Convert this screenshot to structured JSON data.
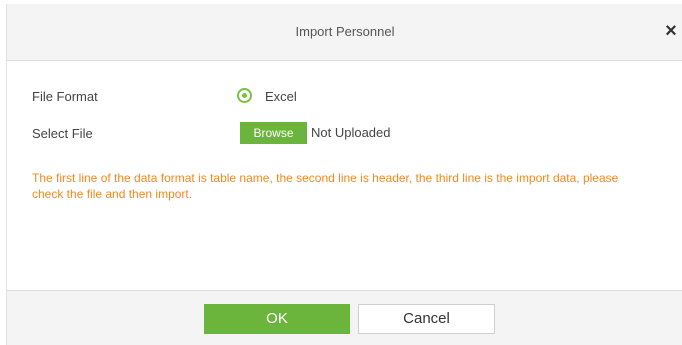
{
  "dialog": {
    "title": "Import Personnel",
    "close_glyph": "×"
  },
  "form": {
    "file_format_label": "File Format",
    "file_format_option": "Excel",
    "file_format_selected": true,
    "select_file_label": "Select File",
    "browse_label": "Browse",
    "upload_status": "Not Uploaded"
  },
  "notice": "The first line of the data format is table name, the second line is header, the third line is the import data, please check the file and then import.",
  "footer": {
    "ok_label": "OK",
    "cancel_label": "Cancel"
  },
  "colors": {
    "accent_green": "#6cb53c",
    "notice_orange": "#f08a24",
    "header_bg": "#f4f4f4"
  },
  "icons": {
    "close": "close-icon",
    "radio": "radio-selected-icon"
  }
}
